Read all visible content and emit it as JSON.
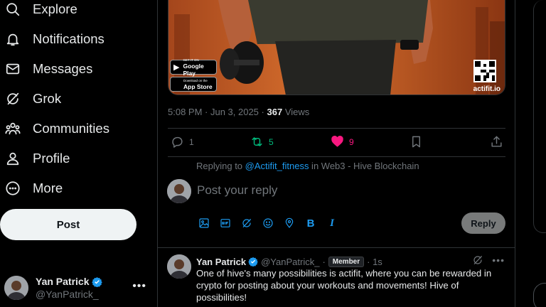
{
  "nav": {
    "items": [
      {
        "label": "Explore",
        "icon": "search-icon"
      },
      {
        "label": "Notifications",
        "icon": "bell-icon"
      },
      {
        "label": "Messages",
        "icon": "envelope-icon"
      },
      {
        "label": "Grok",
        "icon": "grok-icon"
      },
      {
        "label": "Communities",
        "icon": "people-icon"
      },
      {
        "label": "Profile",
        "icon": "person-icon"
      },
      {
        "label": "More",
        "icon": "more-circle-icon"
      }
    ],
    "post_label": "Post"
  },
  "account": {
    "display_name": "Yan Patrick",
    "handle": "@YanPatrick_",
    "verified": true,
    "verified_color": "#1d9bf0"
  },
  "media": {
    "google_play_small": "GET IT ON",
    "google_play_big": "Google Play",
    "app_store_small": "Download on the",
    "app_store_big": "App Store",
    "brand": "actifit.io"
  },
  "post": {
    "time": "5:08 PM · Jun 3, 2025",
    "separator": " · ",
    "views_count": "367",
    "views_label": "Views",
    "replies": "1",
    "reposts": "5",
    "likes": "9",
    "repost_color": "#00ba7c",
    "like_color": "#f91880"
  },
  "reply_box": {
    "replying_prefix": "Replying to ",
    "mention": "@Actifit_fitness",
    "replying_suffix": " in Web3 - Hive Blockchain",
    "placeholder": "Post your reply",
    "reply_label": "Reply",
    "tools": [
      "image-icon",
      "gif-icon",
      "grok-icon",
      "emoji-icon",
      "location-icon",
      "bold-icon",
      "italic-icon"
    ],
    "bold_glyph": "B",
    "italic_glyph": "I"
  },
  "tweet": {
    "display_name": "Yan Patrick",
    "handle": "@YanPatrick_",
    "sep": "·",
    "badge": "Member",
    "age": "· 1s",
    "text": "One of hive's many possibilities is actifit, where you can be rewarded in crypto for posting about your workouts and movements! Hive of possibilities!"
  },
  "accent": "#1d9bf0"
}
